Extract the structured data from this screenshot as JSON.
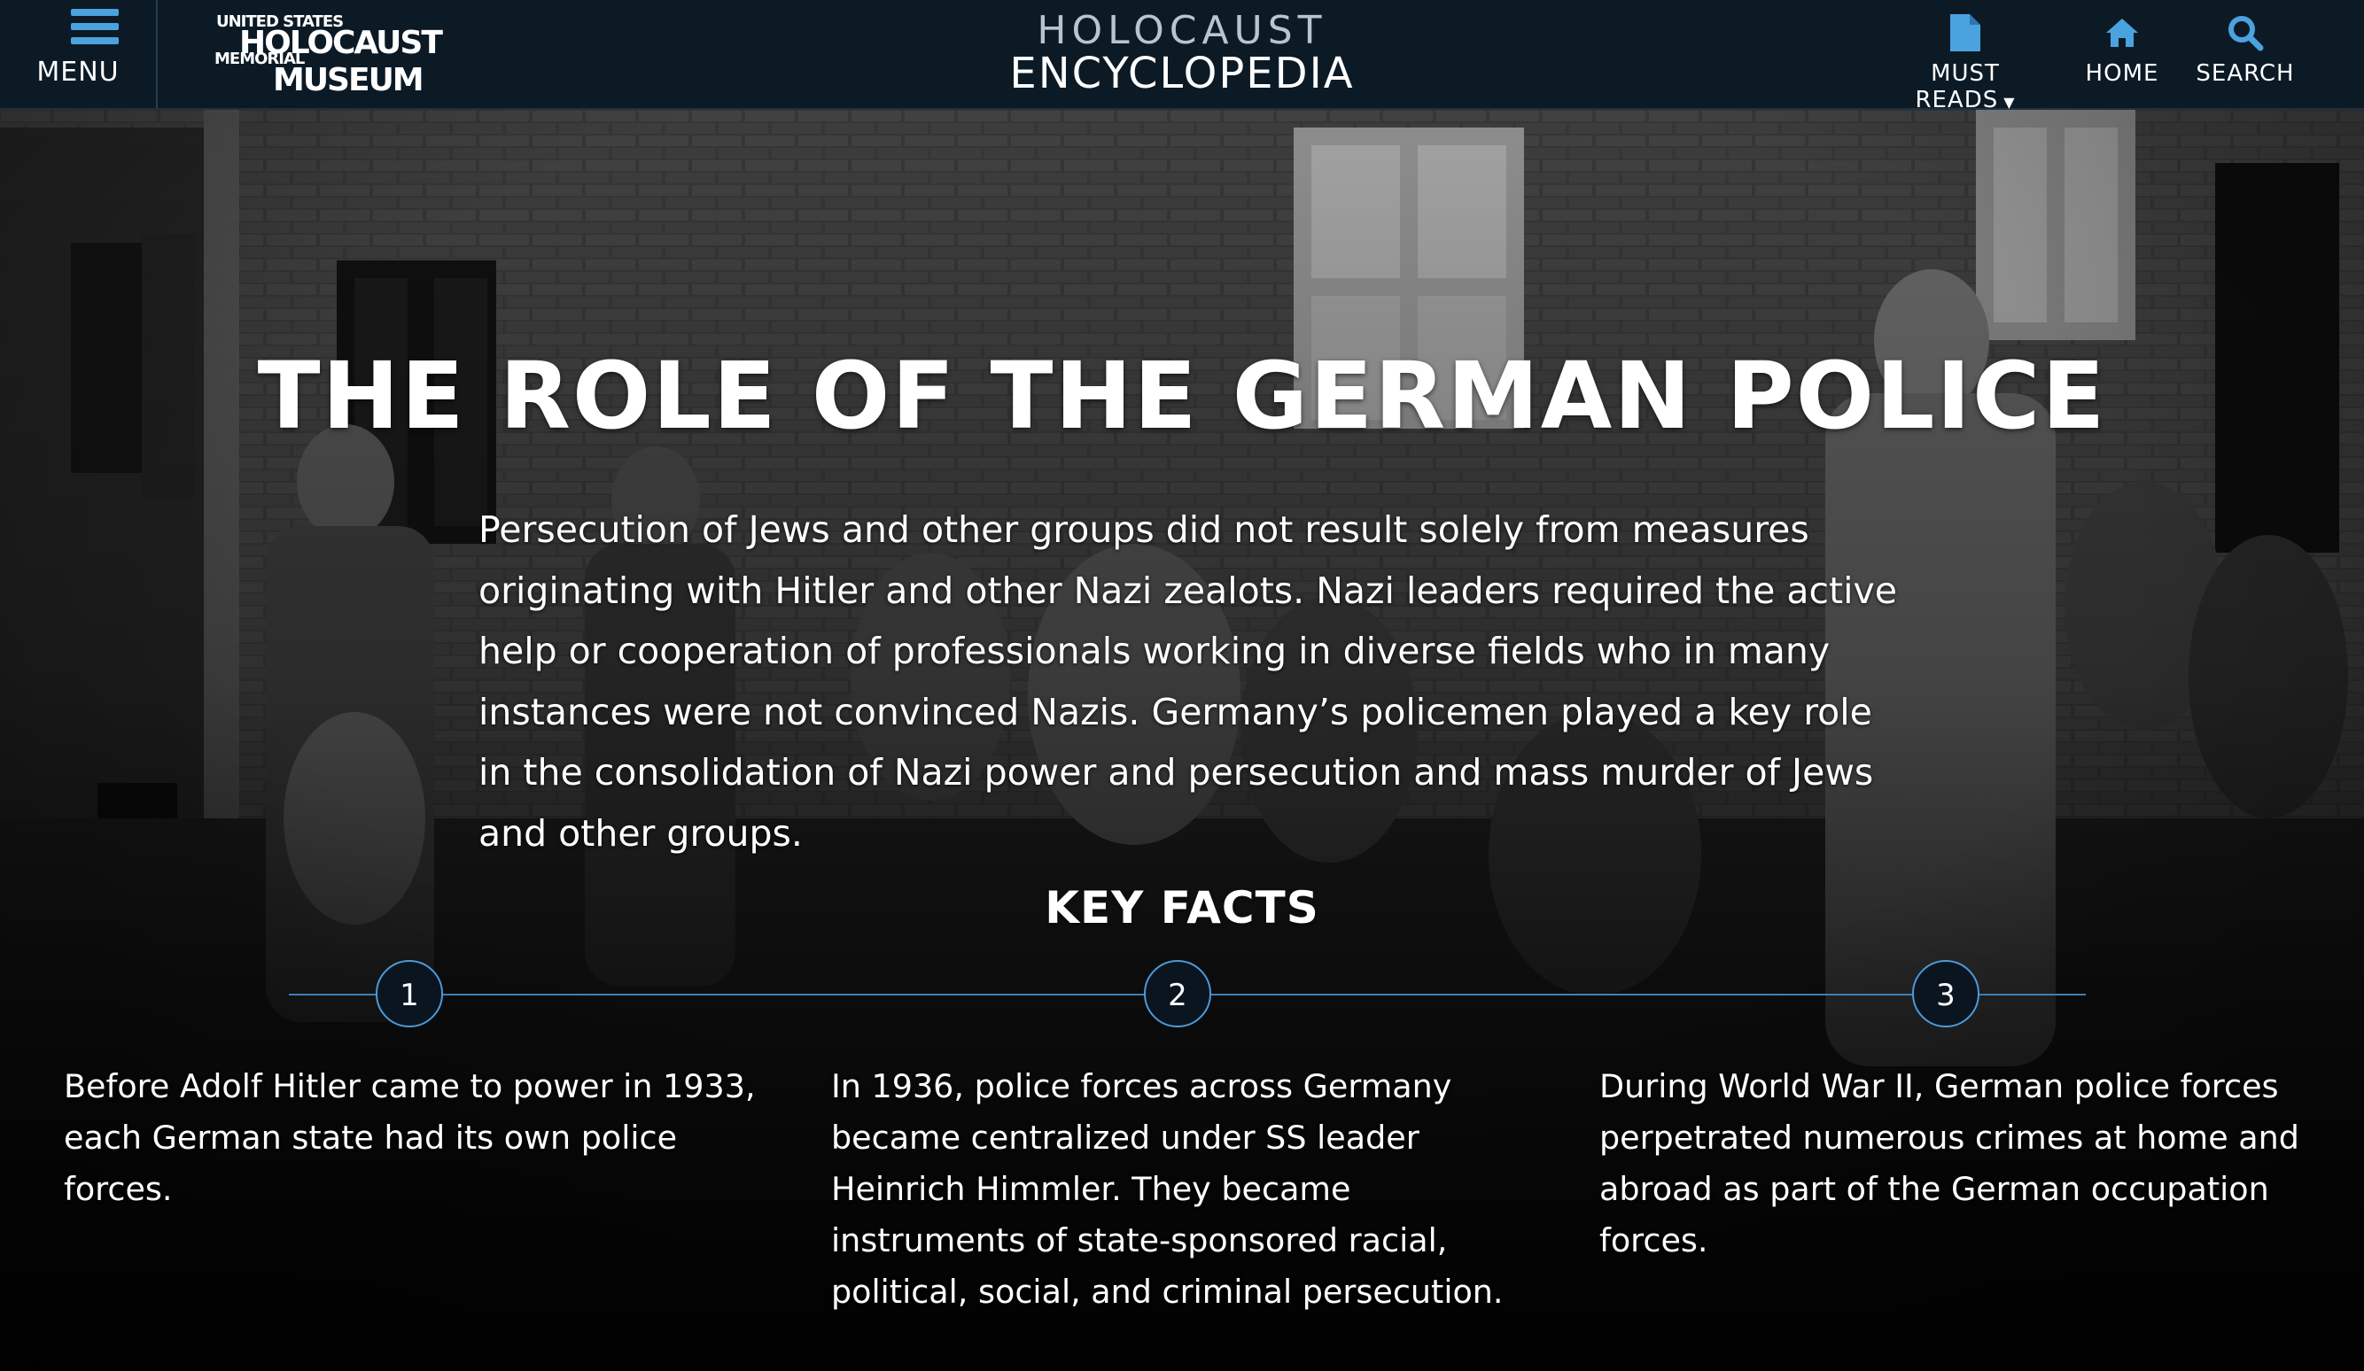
{
  "header": {
    "menu_label": "MENU",
    "logo": {
      "line1": "UNITED STATES",
      "line2": "HOLOCAUST",
      "line3": "MEMORIAL",
      "line4": "MUSEUM"
    },
    "site_title_line1": "HOLOCAUST",
    "site_title_line2": "ENCYCLOPEDIA",
    "nav": {
      "must_reads": "MUST READS",
      "home": "HOME",
      "search": "SEARCH"
    },
    "accent_color": "#4aa3df",
    "background_color": "#0c1a26"
  },
  "hero": {
    "title": "THE ROLE OF THE GERMAN POLICE",
    "intro": "Persecution of Jews and other groups did not result solely from measures originating with Hitler and other Nazi zealots. Nazi leaders required the active help or cooperation of professionals working in diverse fields who in many instances were not convinced Nazis. Germany’s policemen played a key role in the consolidation of Nazi power and persecution and mass murder of Jews and other groups."
  },
  "key_facts": {
    "title": "KEY FACTS",
    "items": [
      {
        "number": "1",
        "text": "Before Adolf Hitler came to power in 1933, each German state had its own police forces."
      },
      {
        "number": "2",
        "text": "In 1936, police forces across Germany became centralized under SS leader Heinrich Himmler. They became instruments of state-sponsored racial, political, social, and criminal persecution."
      },
      {
        "number": "3",
        "text": "During World War II, German police forces perpetrated numerous crimes at home and abroad as part of the German occupation forces."
      }
    ]
  }
}
